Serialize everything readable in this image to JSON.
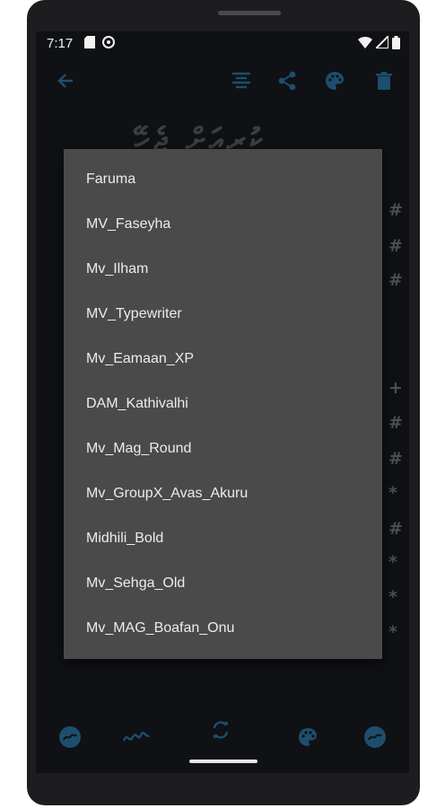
{
  "status": {
    "time": "7:17",
    "icons_left": [
      "sd-card-icon",
      "vpn-icon"
    ],
    "icons_right": [
      "wifi-icon",
      "signal-icon",
      "battery-icon"
    ]
  },
  "toolbar": {
    "icons": [
      "back-arrow-icon",
      "align-center-icon",
      "share-icon",
      "palette-icon",
      "delete-icon"
    ],
    "icon_color": "#1e4e6e"
  },
  "header": {
    "script_text": "ކުރިއަށް ޖެހޭ"
  },
  "side_glyphs": [
    "#",
    "#",
    "#",
    "+",
    "#",
    "#",
    "*",
    "#",
    "*",
    "*",
    "*"
  ],
  "font_menu": {
    "items": [
      "Faruma",
      "MV_Faseyha",
      "Mv_Ilham",
      "MV_Typewriter",
      "Mv_Eamaan_XP",
      "DAM_Kathivalhi",
      "Mv_Mag_Round",
      "Mv_GroupX_Avas_Akuru",
      "Midhili_Bold",
      "Mv_Sehga_Old",
      "Mv_MAG_Boafan_Onu"
    ]
  },
  "bottombar": {
    "icons": [
      "swirl-icon",
      "squiggle-icon",
      "refresh-icon",
      "palette-icon",
      "swirl-icon"
    ]
  },
  "colors": {
    "background": "#0f1114",
    "menu_background": "#4a4a4a",
    "menu_text": "#ececec",
    "icon_blue": "#1e4e6e"
  }
}
